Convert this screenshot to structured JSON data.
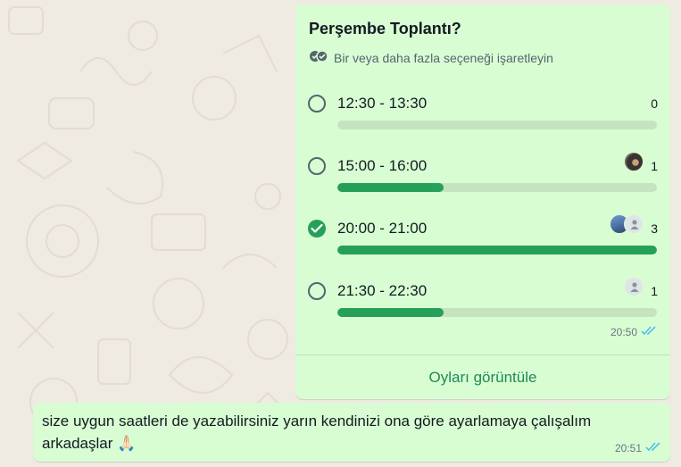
{
  "poll": {
    "title": "Perşembe Toplantı?",
    "subtitle": "Bir veya daha fazla seçeneği işaretleyin",
    "options": [
      {
        "label": "12:30 - 13:30",
        "count": "0",
        "fill": 0.0,
        "checked": false
      },
      {
        "label": "15:00 - 16:00",
        "count": "1",
        "fill": 0.333,
        "checked": false
      },
      {
        "label": "20:00 - 21:00",
        "count": "3",
        "fill": 1.0,
        "checked": true
      },
      {
        "label": "21:30 - 22:30",
        "count": "1",
        "fill": 0.333,
        "checked": false
      }
    ],
    "time": "20:50",
    "view_votes_label": "Oyları görüntüle"
  },
  "message": {
    "text": "size uygun saatleri de yazabilirsiniz yarın kendinizi ona göre ayarlamaya çalışalım arkadaşlar 🙏🏻",
    "time": "20:51"
  },
  "colors": {
    "bubble": "#d9fdd3",
    "accent": "#25a05a",
    "track": "#c6e3c0",
    "read_ticks": "#53bdeb",
    "background": "#efeae2"
  },
  "icons": {
    "subtitle": "double-check-icon",
    "checked_radio": "checkmark-icon",
    "status": "double-tick-read-icon",
    "placeholder_avatar": "person-icon"
  }
}
